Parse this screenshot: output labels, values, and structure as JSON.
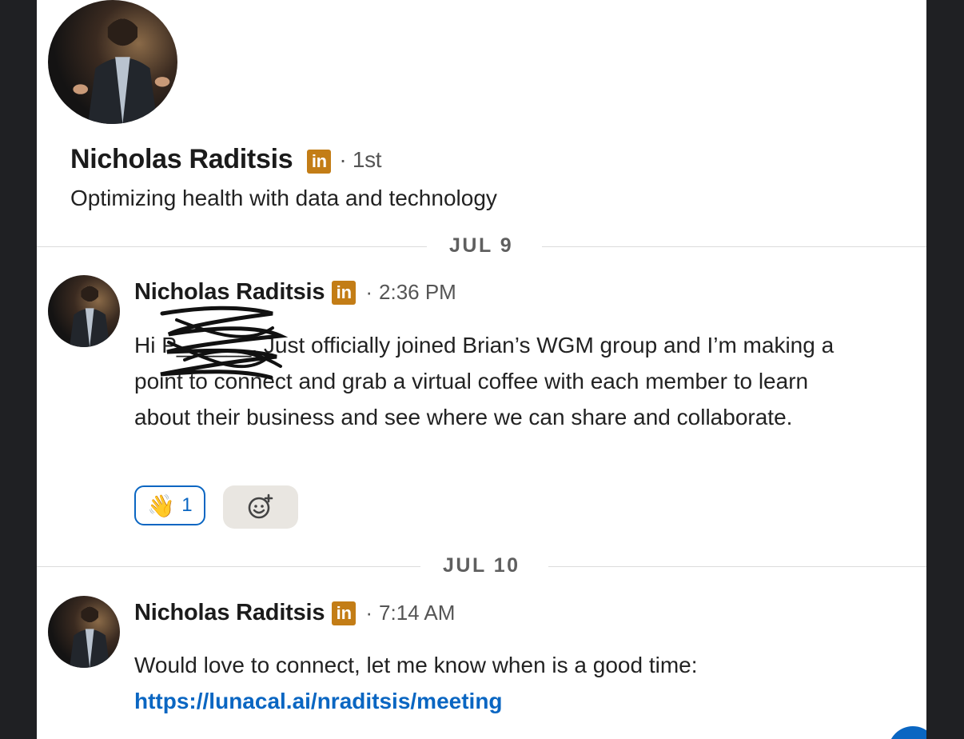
{
  "header": {
    "name": "Nicholas Raditsis",
    "badge": "in",
    "degree": "· 1st",
    "headline": "Optimizing health with data and technology"
  },
  "dates": [
    "JUL 9",
    "JUL 10"
  ],
  "messages": [
    {
      "sender": "Nicholas Raditsis",
      "badge": "in",
      "separator": "·",
      "time": "2:36 PM",
      "text": "Hi P______, Just officially joined Brian’s WGM group and I’m making a point to connect and grab a virtual coffee with each member to learn about their business and see where we can share and collaborate.",
      "reaction": {
        "emoji": "👋",
        "count": "1"
      }
    },
    {
      "sender": "Nicholas Raditsis",
      "badge": "in",
      "separator": "·",
      "time": "7:14 AM",
      "text_prefix": "Would love to connect, let me know when is a good time:",
      "link": "https://lunacal.ai/nraditsis/meeting"
    }
  ],
  "icons": {
    "linkedin": "linkedin-icon",
    "add_reaction": "smiley-plus-icon",
    "fab": "compose-icon"
  },
  "colors": {
    "link": "#0a66c2",
    "badge": "#c37d16"
  }
}
